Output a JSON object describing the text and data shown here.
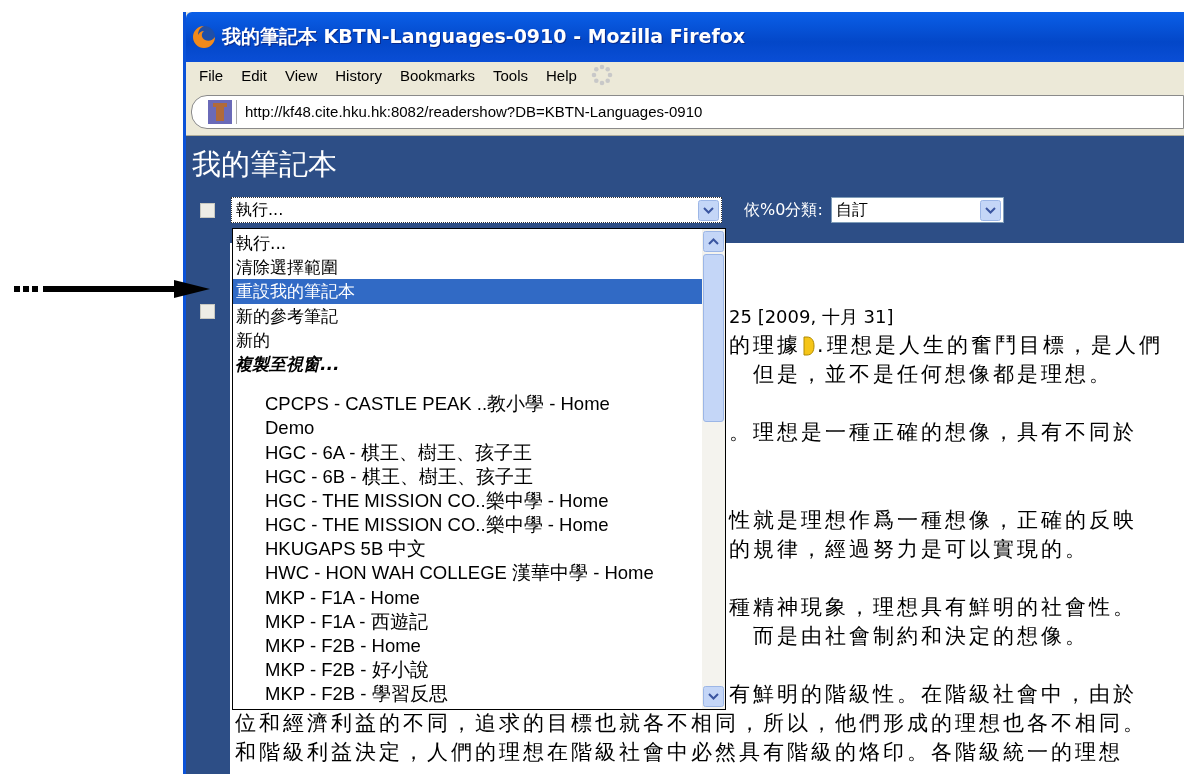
{
  "window": {
    "title": "我的筆記本 KBTN-Languages-0910 - Mozilla Firefox"
  },
  "menu": [
    "File",
    "Edit",
    "View",
    "History",
    "Bookmarks",
    "Tools",
    "Help"
  ],
  "address_bar": {
    "url": "http://kf48.cite.hku.hk:8082/readershow?DB=KBTN-Languages-0910"
  },
  "page": {
    "title": "我的筆記本",
    "toolbar": {
      "select_all": {
        "checked": false
      },
      "action_select": {
        "value": "執行..."
      },
      "sort_label": "依%0分類:",
      "sort_select": {
        "value": "自訂"
      }
    },
    "dropdown": {
      "options": [
        {
          "label": "執行...",
          "selected": false
        },
        {
          "label": "清除選擇範圍",
          "selected": false
        },
        {
          "label": "重設我的筆記本",
          "selected": true
        },
        {
          "label": "新的參考筆記",
          "selected": false
        },
        {
          "label": "新的",
          "selected": false
        }
      ],
      "group": {
        "label": "複製至視窗...",
        "options": [
          {
            "label": "CPCPS - CASTLE PEAK ..教小學 - Home",
            "selected": false
          },
          {
            "label": "Demo",
            "selected": false
          },
          {
            "label": "HGC - 6A - 棋王、樹王、孩子王",
            "selected": false
          },
          {
            "label": "HGC - 6B - 棋王、樹王、孩子王",
            "selected": false
          },
          {
            "label": "HGC - THE MISSION CO..樂中學 - Home",
            "selected": false
          },
          {
            "label": "HGC - THE MISSION CO..樂中學 - Home",
            "selected": false
          },
          {
            "label": "HKUGAPS 5B 中文",
            "selected": false
          },
          {
            "label": "HWC - HON WAH COLLEGE 漢華中學 - Home",
            "selected": false
          },
          {
            "label": "MKP - F1A - Home",
            "selected": false
          },
          {
            "label": "MKP - F1A - 西遊記",
            "selected": false
          },
          {
            "label": "MKP - F2B - Home",
            "selected": false
          },
          {
            "label": "MKP - F2B - 好小說",
            "selected": false
          },
          {
            "label": "MKP - F2B - 學習反思",
            "selected": false
          }
        ]
      }
    },
    "note": {
      "checked": false,
      "paragraphs": [
        [
          {
            "kind": "partial",
            "text": "25 [2009, 十月 31]"
          },
          {
            "kind": "partial",
            "text": "的理據",
            "marker": true,
            "after": ".理想是人生的奮鬥目標，是人們"
          },
          {
            "kind": "partial",
            "text": "　但是，並不是任何想像都是理想。"
          }
        ],
        [
          {
            "kind": "partial",
            "text": "。理想是一種正確的想像，具有不同於"
          }
        ],
        [
          {
            "kind": "partial",
            "text": "性就是理想作爲一種想像，正確的反映"
          },
          {
            "kind": "partial",
            "text": "的規律，經過努力是可以實現的。"
          }
        ],
        [
          {
            "kind": "partial",
            "text": "種精神現象，理想具有鮮明的社會性。"
          },
          {
            "kind": "partial",
            "text": "　而是由社會制約和決定的想像。"
          }
        ],
        [
          {
            "kind": "partial",
            "text": "有鮮明的階級性。在階級社會中，由於"
          },
          {
            "kind": "full",
            "text": "位和經濟利益的不同，追求的目標也就各不相同，所以，他們形成的理想也各不相同。"
          },
          {
            "kind": "full",
            "text": "和階級利益決定，人們的理想在階級社會中必然具有階級的烙印。各階級統一的理想"
          }
        ]
      ]
    }
  }
}
